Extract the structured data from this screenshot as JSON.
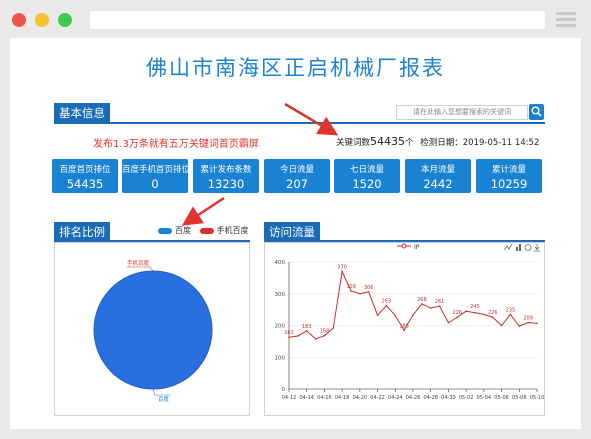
{
  "page": {
    "title": "佛山市南海区正启机械厂报表"
  },
  "basic": {
    "section_title": "基本信息",
    "search_placeholder": "请在此输入您想要搜索的关键词",
    "promo": "发布1.3万条就有五万关键词首页霸屏",
    "keyword_label": "关键词数",
    "keyword_count": "54435",
    "keyword_unit": "个",
    "check_date_label": "检测日期：",
    "check_date": "2019-05-11 14:52"
  },
  "stats": [
    {
      "label": "百度首页排位",
      "value": "54435"
    },
    {
      "label": "百度手机首页排位",
      "value": "0"
    },
    {
      "label": "累计发布条数",
      "value": "13230"
    },
    {
      "label": "今日流量",
      "value": "207"
    },
    {
      "label": "七日流量",
      "value": "1520"
    },
    {
      "label": "本月流量",
      "value": "2442"
    },
    {
      "label": "累计流量",
      "value": "10259"
    }
  ],
  "ranking": {
    "section_title": "排名比例",
    "legend": [
      {
        "name": "百度",
        "color": "#1a82d2"
      },
      {
        "name": "手机百度",
        "color": "#d9302a"
      }
    ],
    "labels": {
      "mobile": "手机百度",
      "baidu": "百度"
    }
  },
  "traffic": {
    "section_title": "访问流量",
    "legend_label": "IP",
    "toolbar_icons": [
      "line-chart-icon",
      "bar-chart-icon",
      "refresh-icon",
      "download-icon"
    ]
  },
  "colors": {
    "accent": "#1a82d2",
    "dark_accent": "#1a6bb8",
    "promo": "#e0332f",
    "line": "#c7312c"
  },
  "chart_data": [
    {
      "type": "pie",
      "categories": [
        "百度",
        "手机百度"
      ],
      "values": [
        54435,
        0
      ],
      "legend_position": "top"
    },
    {
      "type": "line",
      "series": [
        {
          "name": "IP",
          "values": [
            163,
            167,
            183,
            158,
            168,
            192,
            370,
            309,
            300,
            306,
            232,
            263,
            231,
            185,
            233,
            268,
            255,
            261,
            209,
            226,
            245,
            240,
            235,
            226,
            200,
            235,
            198,
            209,
            207
          ]
        }
      ],
      "data_labels": [
        {
          "index": 0,
          "value": 163
        },
        {
          "index": 2,
          "value": 183
        },
        {
          "index": 4,
          "value": 168
        },
        {
          "index": 6,
          "value": 370
        },
        {
          "index": 7,
          "value": 309
        },
        {
          "index": 9,
          "value": 306
        },
        {
          "index": 11,
          "value": 263
        },
        {
          "index": 13,
          "value": 185
        },
        {
          "index": 15,
          "value": 268
        },
        {
          "index": 17,
          "value": 261
        },
        {
          "index": 19,
          "value": 226
        },
        {
          "index": 21,
          "value": 245
        },
        {
          "index": 23,
          "value": 226
        },
        {
          "index": 25,
          "value": 235
        },
        {
          "index": 27,
          "value": 209
        }
      ],
      "x_tick_labels": [
        "04-12",
        "04-14",
        "04-16",
        "04-18",
        "04-20",
        "04-22",
        "04-24",
        "04-26",
        "04-28",
        "04-30",
        "05-02",
        "05-04",
        "05-06",
        "05-08",
        "05-10"
      ],
      "ylim": [
        0,
        400
      ],
      "y_ticks": [
        0,
        100,
        200,
        300,
        400
      ],
      "grid": true,
      "legend_position": "top"
    }
  ]
}
